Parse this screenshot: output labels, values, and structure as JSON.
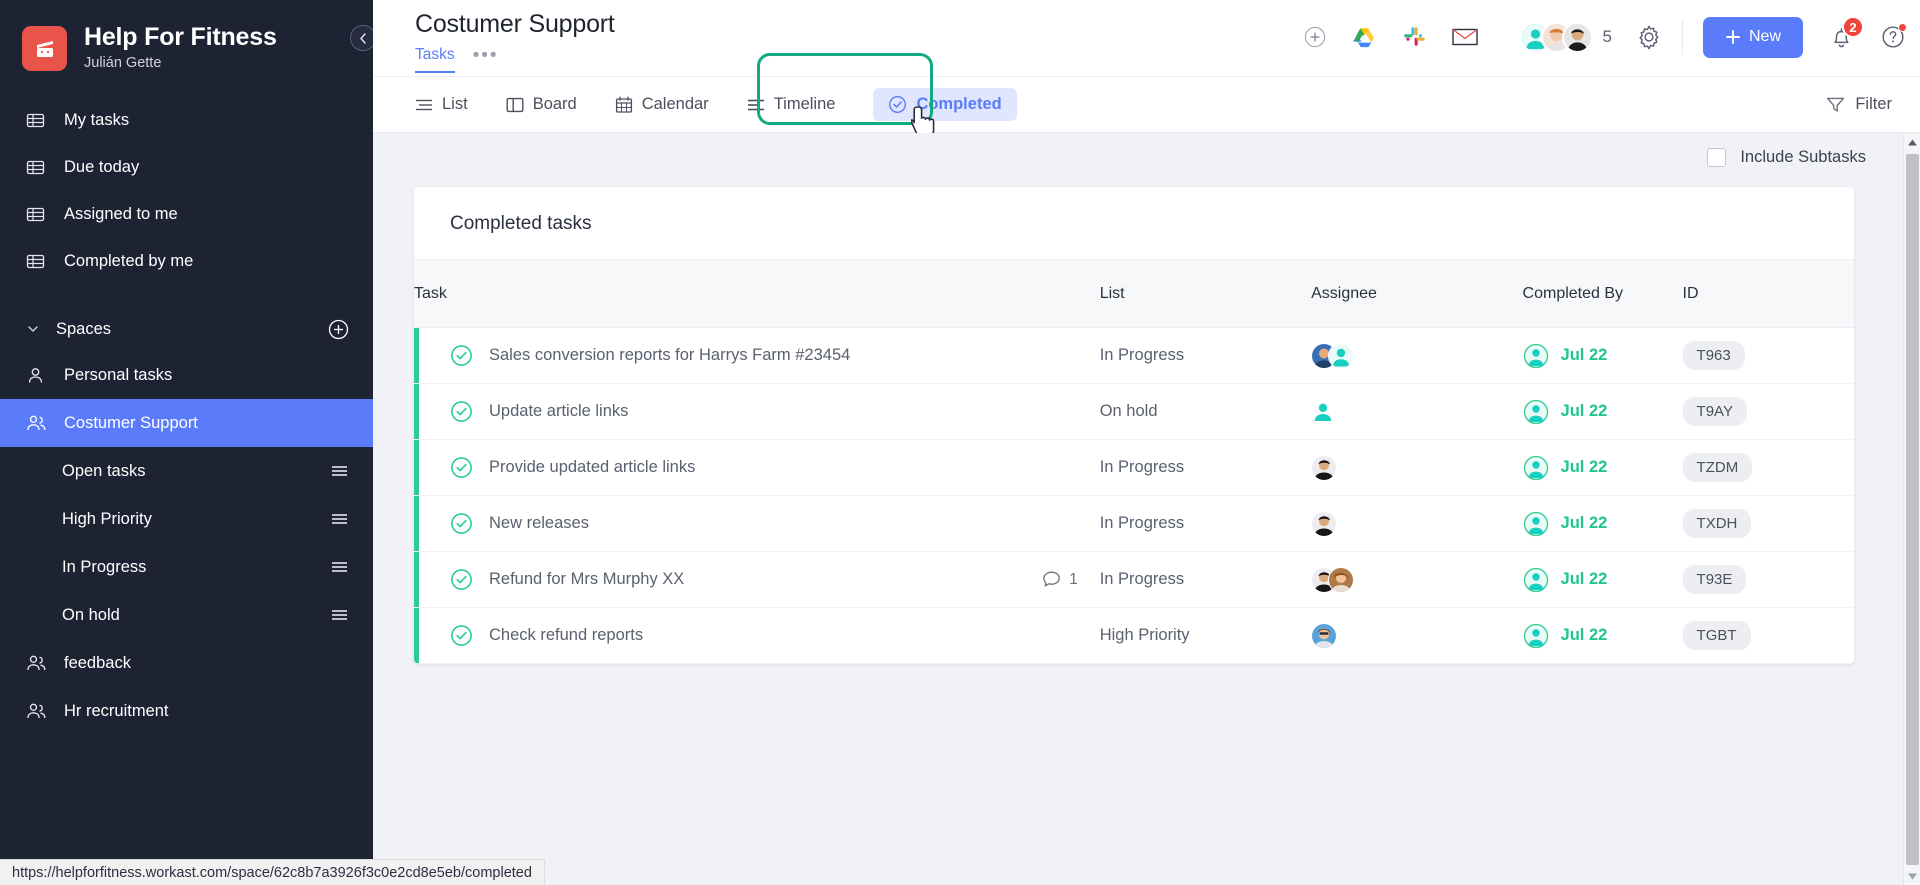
{
  "sidebar": {
    "brand": {
      "title": "Help For Fitness",
      "user": "Julián Gette",
      "logo_icon": "flag-logo-icon",
      "logo_color": "#e8544a"
    },
    "collapse_icon": "chevron-left-circle-icon",
    "nav_items": [
      {
        "label": "My tasks",
        "icon": "table-icon"
      },
      {
        "label": "Due today",
        "icon": "table-icon"
      },
      {
        "label": "Assigned to me",
        "icon": "table-icon"
      },
      {
        "label": "Completed by me",
        "icon": "table-icon"
      }
    ],
    "spaces_section": {
      "label": "Spaces",
      "caret_icon": "chevron-down-icon",
      "add_icon": "plus-circle-icon"
    },
    "spaces": [
      {
        "label": "Personal tasks",
        "icon": "user-icon",
        "active": false
      },
      {
        "label": "Costumer Support",
        "icon": "users-icon",
        "active": true
      }
    ],
    "space_lists": [
      {
        "label": "Open tasks",
        "handle_icon": "menu-handle-icon"
      },
      {
        "label": "High Priority",
        "handle_icon": "menu-handle-icon"
      },
      {
        "label": "In Progress",
        "handle_icon": "menu-handle-icon"
      },
      {
        "label": "On hold",
        "handle_icon": "menu-handle-icon"
      }
    ],
    "more_spaces": [
      {
        "label": "feedback",
        "icon": "users-icon"
      },
      {
        "label": "Hr recruitment",
        "icon": "users-icon"
      }
    ],
    "active_color": "#5b7cfa",
    "background": "#1e2334"
  },
  "header": {
    "title": "Costumer Support",
    "subtabs": [
      {
        "label": "Tasks",
        "active": true
      }
    ],
    "more_label": "•••",
    "integrations": [
      {
        "name": "add-integration-icon",
        "label": "+"
      },
      {
        "name": "google-drive-icon",
        "label": "Google Drive"
      },
      {
        "name": "slack-icon",
        "label": "Slack"
      },
      {
        "name": "email-icon",
        "label": "Email"
      }
    ],
    "members_count": "5",
    "gear_icon": "gear-icon",
    "new_button": {
      "label": "New",
      "icon": "plus-icon",
      "color": "#5b7cfa"
    },
    "notifications": {
      "icon": "bell-icon",
      "badge": "2",
      "badge_color": "#f0453a"
    },
    "help": {
      "icon": "help-circle-icon",
      "has_dot": true
    }
  },
  "viewbar": {
    "tabs": [
      {
        "label": "List",
        "icon": "list-icon",
        "active": false
      },
      {
        "label": "Board",
        "icon": "board-icon",
        "active": false
      },
      {
        "label": "Calendar",
        "icon": "calendar-icon",
        "active": false
      },
      {
        "label": "Timeline",
        "icon": "timeline-icon",
        "active": false
      },
      {
        "label": "Completed",
        "icon": "check-circle-icon",
        "active": true
      }
    ],
    "filter": {
      "label": "Filter",
      "icon": "filter-icon"
    },
    "highlight_color": "#13a983"
  },
  "content": {
    "include_subtasks": {
      "label": "Include Subtasks",
      "checked": false
    },
    "card_title": "Completed tasks",
    "columns": [
      "Task",
      "List",
      "Assignee",
      "Completed By",
      "ID"
    ],
    "rows": [
      {
        "task": "Sales conversion reports for Harrys Farm #23454",
        "comments": "",
        "list": "In Progress",
        "assignees": 2,
        "assignee_style": [
          "photo-blue",
          "silhouette"
        ],
        "completed_by_icon": "user-circle-icon",
        "completed_date": "Jul 22",
        "id": "T963"
      },
      {
        "task": "Update article links",
        "comments": "",
        "list": "On hold",
        "assignees": 1,
        "assignee_style": [
          "silhouette"
        ],
        "completed_by_icon": "user-circle-icon",
        "completed_date": "Jul 22",
        "id": "T9AY"
      },
      {
        "task": "Provide updated article links",
        "comments": "",
        "list": "In Progress",
        "assignees": 1,
        "assignee_style": [
          "photo-dark"
        ],
        "completed_by_icon": "user-circle-icon",
        "completed_date": "Jul 22",
        "id": "TZDM"
      },
      {
        "task": "New releases",
        "comments": "",
        "list": "In Progress",
        "assignees": 1,
        "assignee_style": [
          "photo-dark"
        ],
        "completed_by_icon": "user-circle-icon",
        "completed_date": "Jul 22",
        "id": "TXDH"
      },
      {
        "task": "Refund for Mrs Murphy XX",
        "comments": "1",
        "list": "In Progress",
        "assignees": 2,
        "assignee_style": [
          "photo-dark",
          "photo-red"
        ],
        "completed_by_icon": "user-circle-icon",
        "completed_date": "Jul 22",
        "id": "T93E"
      },
      {
        "task": "Check refund reports",
        "comments": "",
        "list": "High Priority",
        "assignees": 1,
        "assignee_style": [
          "photo-blue2"
        ],
        "completed_by_icon": "user-circle-icon",
        "completed_date": "Jul 22",
        "id": "TGBT"
      }
    ],
    "accent_green": "#2ecc8f",
    "date_color": "#1fc68b"
  },
  "statusbar": {
    "url": "https://helpforfitness.workast.com/space/62c8b7a3926f3c0e2cd8e5eb/completed"
  }
}
